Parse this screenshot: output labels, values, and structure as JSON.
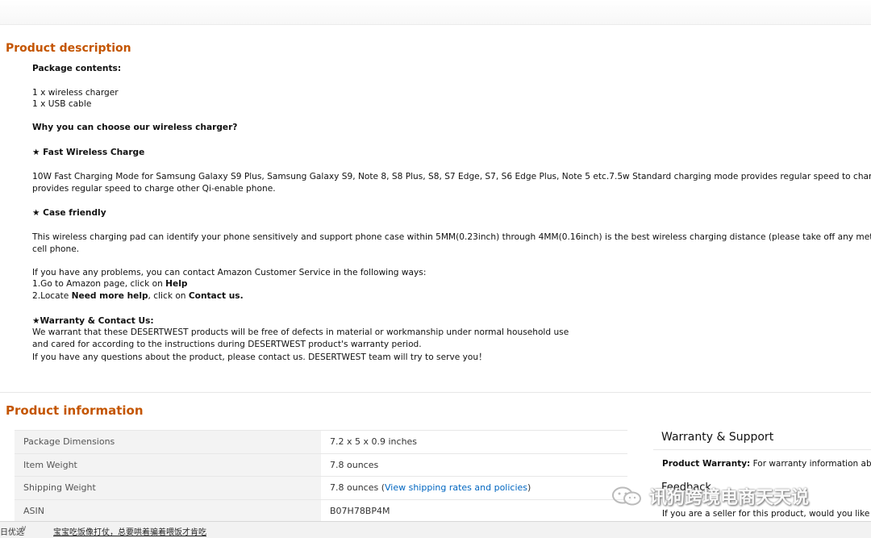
{
  "product_description": {
    "title": "Product description",
    "package_contents_heading": "Package contents:",
    "package_items": [
      "1 x wireless charger",
      "1 x USB cable"
    ],
    "why_heading": "Why you can choose our wireless charger?",
    "fast_heading": "★ Fast Wireless Charge",
    "fast_text_1": "10W Fast Charging Mode for Samsung Galaxy S9 Plus, Samsung Galaxy S9, Note 8, S8 Plus, S8, S7 Edge, S7, S6 Edge Plus, Note 5 etc.7.5w Standard charging mode provides regular speed to charge iPhone",
    "fast_text_2": "provides regular speed to charge other Qi-enable phone.",
    "case_heading": "★ Case friendly",
    "case_text_1": "This wireless charging pad can identify your phone sensitively and support phone case within 5MM(0.23inch) through 4MM(0.16inch) is the best wireless charging distance (please take off any metal acces",
    "case_text_2": "cell phone.",
    "problems_text": "If you have any problems, you can contact Amazon Customer Service in the following ways:",
    "step1_prefix": "1.Go to Amazon page, click on ",
    "step1_bold": "Help",
    "step2_prefix": "2.Locate ",
    "step2_bold1": "Need more help",
    "step2_mid": ", click on ",
    "step2_bold2": "Contact us.",
    "warranty_heading": "★Warranty & Contact Us:",
    "warranty_1": "We warrant that these DESERTWEST products will be free of defects in material or workmanship under normal household use",
    "warranty_2": "and cared for according to the instructions during DESERTWEST product's warranty period.",
    "warranty_3": "If you have any questions about the product, please contact us. DESERTWEST team will try to serve you！"
  },
  "product_information": {
    "title": "Product information",
    "rows": [
      {
        "label": "Package Dimensions",
        "value": "7.2 x 5 x 0.9 inches"
      },
      {
        "label": "Item Weight",
        "value": "7.8 ounces"
      },
      {
        "label": "Shipping Weight",
        "value": "7.8 ounces (",
        "link": "View shipping rates and policies",
        "suffix": ")"
      },
      {
        "label": "ASIN",
        "value": "B07H78BP4M"
      }
    ]
  },
  "warranty_support": {
    "title": "Warranty & Support",
    "label": "Product Warranty:",
    "text": " For warranty information abou"
  },
  "feedback": {
    "title": "Feedback",
    "text": "If you are a seller for this product, would you like to"
  },
  "watermark": {
    "text": "讯狗跨境电商天天说",
    "icon": "wechat-icon"
  },
  "bottom_bar": {
    "left_text": "日优选",
    "chevron": "∨",
    "link_text": "宝宝吃饭像打仗，总要哄着骗着喂饭才肯吃"
  },
  "colors": {
    "section_title": "#c45500",
    "link": "#0066c0",
    "row_label_bg": "#f3f3f3"
  }
}
